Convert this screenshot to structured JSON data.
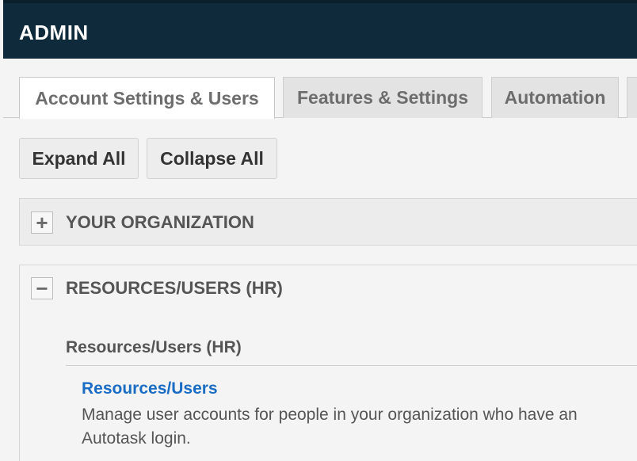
{
  "header": {
    "title": "ADMIN"
  },
  "tabs": [
    {
      "label": "Account Settings & Users",
      "active": true
    },
    {
      "label": "Features & Settings",
      "active": false
    },
    {
      "label": "Automation",
      "active": false
    }
  ],
  "toolbar": {
    "expand_label": "Expand All",
    "collapse_label": "Collapse All"
  },
  "sections": [
    {
      "title": "YOUR ORGANIZATION",
      "toggle": "+",
      "expanded": false
    },
    {
      "title": "RESOURCES/USERS (HR)",
      "toggle": "−",
      "expanded": true,
      "subsection": {
        "title": "Resources/Users (HR)",
        "items": [
          {
            "link": "Resources/Users",
            "description": "Manage user accounts for people in your organization who have an Autotask login."
          }
        ]
      }
    }
  ],
  "colors": {
    "header_bg": "#0f2a3a",
    "link": "#1a6dc2",
    "tab_inactive_bg": "#e3e3e3",
    "tab_active_bg": "#ffffff"
  }
}
